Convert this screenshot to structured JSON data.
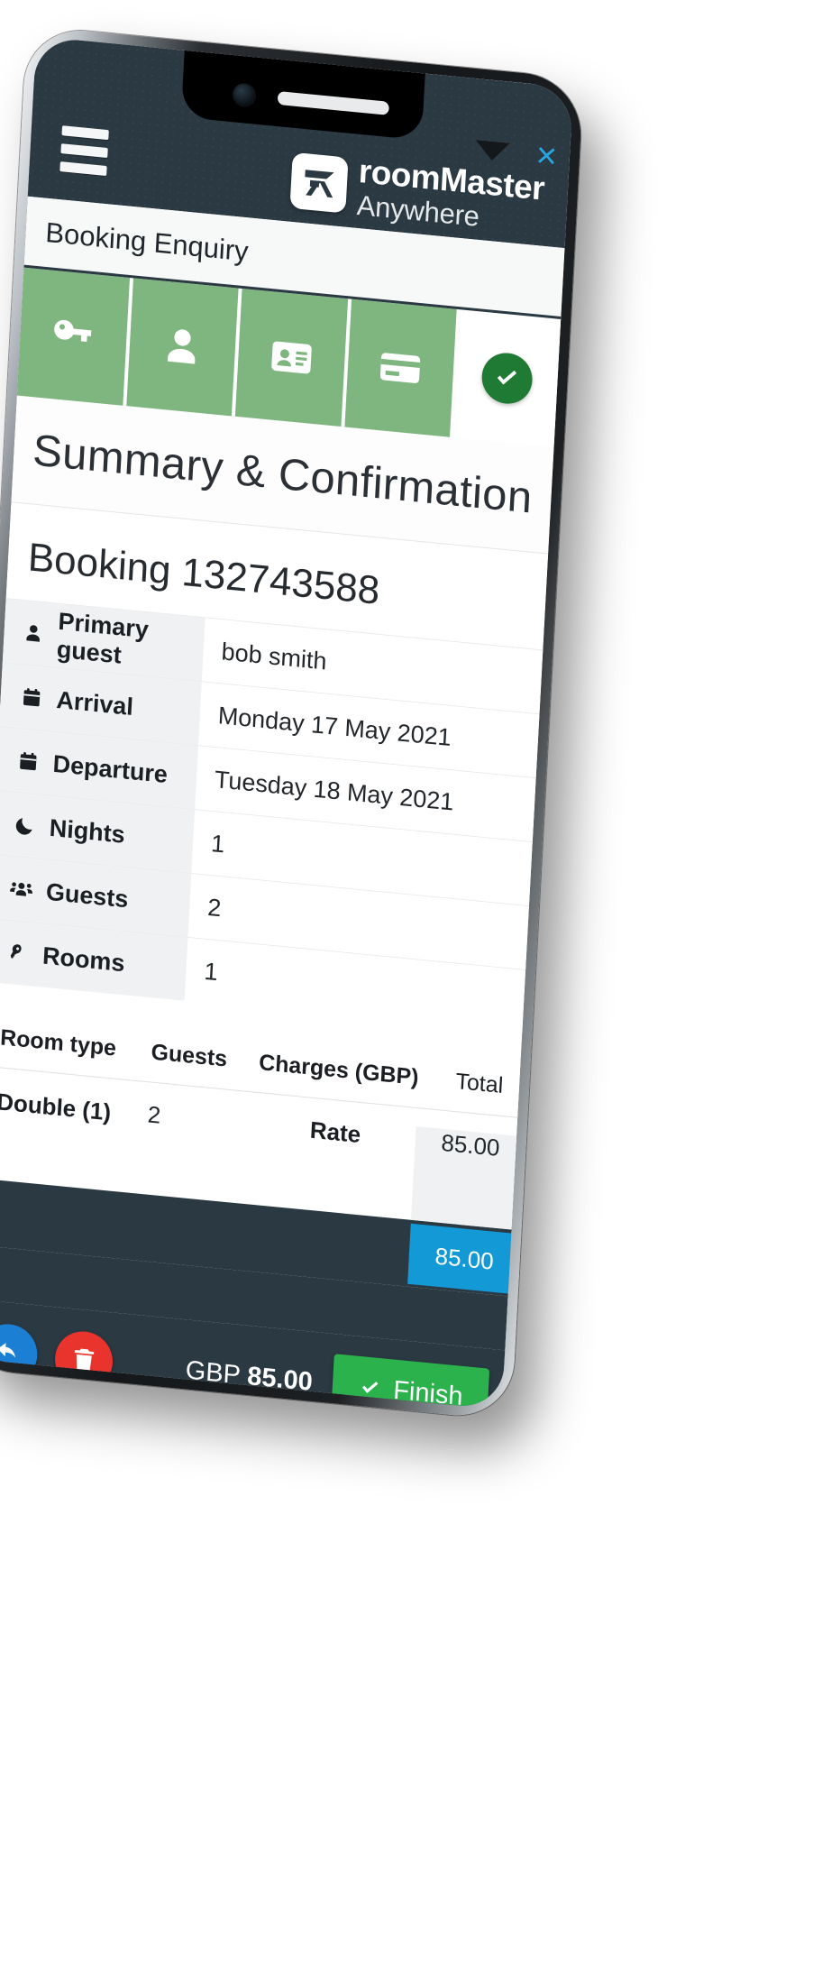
{
  "app": {
    "header": {
      "menu_icon": "hamburger-menu-icon",
      "logo_line1": "roomMaster",
      "logo_line2": "Anywhere",
      "logo_mark_icon": "roommaster-logo-mark"
    },
    "enquiry_bar": {
      "title": "Booking Enquiry",
      "expand_icon": "caret-down-icon",
      "close_label": "×"
    },
    "steps": [
      {
        "icon": "key-icon",
        "name": "rooms-step",
        "state": "complete"
      },
      {
        "icon": "person-icon",
        "name": "guest-step",
        "state": "complete"
      },
      {
        "icon": "id-card-icon",
        "name": "details-step",
        "state": "complete"
      },
      {
        "icon": "credit-card-icon",
        "name": "payment-step",
        "state": "complete"
      },
      {
        "icon": "check-circle-icon",
        "name": "confirmation-step",
        "state": "current"
      }
    ],
    "page_title": "Summary & Confirmation",
    "booking_heading": "Booking 132743588",
    "details": [
      {
        "icon": "person-icon",
        "label": "Primary guest",
        "value": "bob smith"
      },
      {
        "icon": "calendar-icon",
        "label": "Arrival",
        "value": "Monday 17 May 2021"
      },
      {
        "icon": "calendar-icon",
        "label": "Departure",
        "value": "Tuesday 18 May 2021"
      },
      {
        "icon": "moon-icon",
        "label": "Nights",
        "value": "1"
      },
      {
        "icon": "people-icon",
        "label": "Guests",
        "value": "2"
      },
      {
        "icon": "key-icon",
        "label": "Rooms",
        "value": "1"
      }
    ],
    "charges_table": {
      "headers": {
        "room_type": "Room type",
        "guests": "Guests",
        "charges": "Charges (GBP)",
        "total": "Total"
      },
      "rows": [
        {
          "room_type": "Double (1)",
          "guests": "2",
          "charge_label": "Rate",
          "total": "85.00"
        }
      ],
      "grand_total": "85.00"
    },
    "action_bar": {
      "back_icon": "undo-arrow-icon",
      "delete_icon": "trash-icon",
      "price_currency": "GBP",
      "price_amount": "85.00",
      "finish_label": "Finish",
      "finish_icon": "check-icon"
    },
    "nav_bar": {
      "back_icon": "nav-back-icon",
      "home_icon": "nav-home-icon",
      "recents_icon": "nav-recents-icon"
    },
    "colors": {
      "header_dark": "#2b3943",
      "step_green": "#7fb680",
      "accent_blue": "#1399d6",
      "finish_green": "#2bb24c",
      "delete_red": "#e8342c",
      "back_blue": "#1b7fd4",
      "close_blue": "#27a7e0"
    }
  }
}
